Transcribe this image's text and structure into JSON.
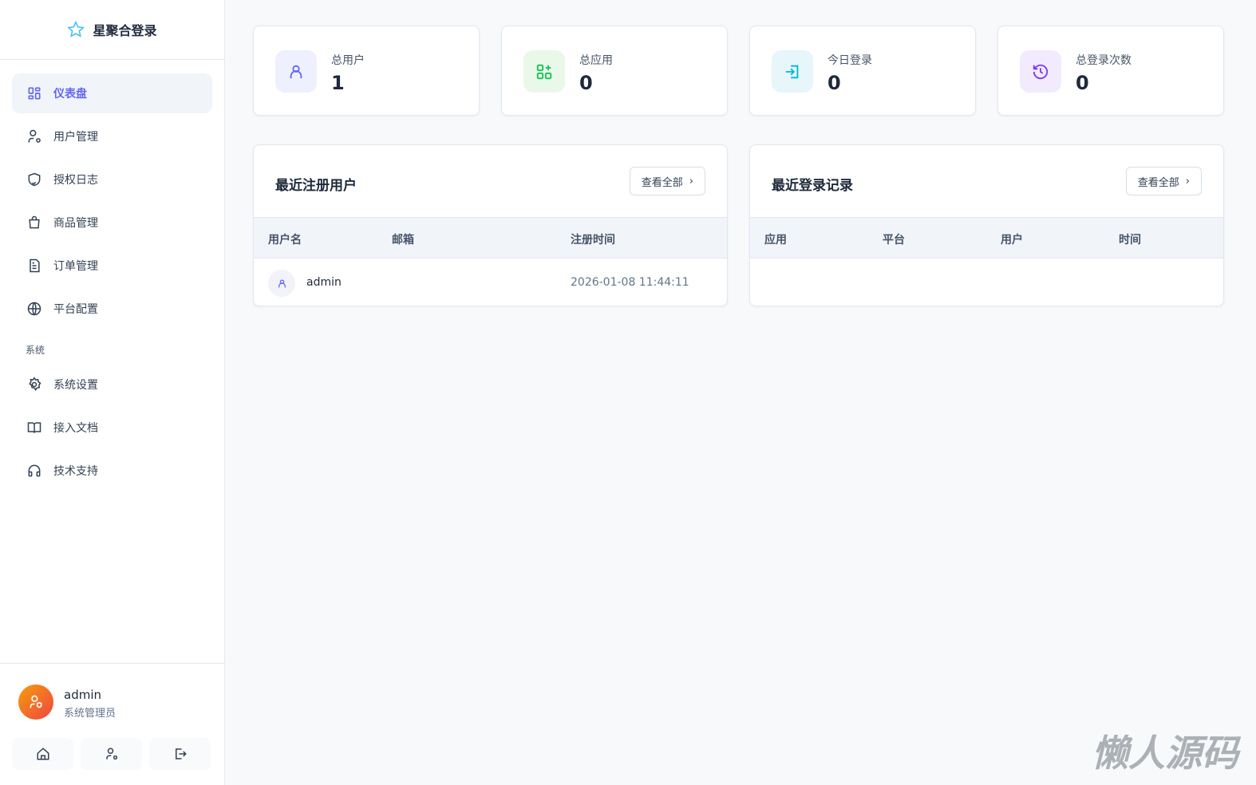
{
  "brand": {
    "title": "星聚合登录"
  },
  "nav": {
    "items": [
      {
        "label": "仪表盘"
      },
      {
        "label": "用户管理"
      },
      {
        "label": "授权日志"
      },
      {
        "label": "商品管理"
      },
      {
        "label": "订单管理"
      },
      {
        "label": "平台配置"
      }
    ],
    "section": "系统",
    "system_items": [
      {
        "label": "系统设置"
      },
      {
        "label": "接入文档"
      },
      {
        "label": "技术支持"
      }
    ]
  },
  "user": {
    "name": "admin",
    "role": "系统管理员"
  },
  "stats": [
    {
      "label": "总用户",
      "value": "1"
    },
    {
      "label": "总应用",
      "value": "0"
    },
    {
      "label": "今日登录",
      "value": "0"
    },
    {
      "label": "总登录次数",
      "value": "0"
    }
  ],
  "recent_users": {
    "title": "最近注册用户",
    "view_all": "查看全部",
    "columns": [
      "用户名",
      "邮箱",
      "注册时间"
    ],
    "rows": [
      {
        "username": "admin",
        "email": "",
        "time": "2026-01-08 11:44:11"
      }
    ]
  },
  "recent_logins": {
    "title": "最近登录记录",
    "view_all": "查看全部",
    "columns": [
      "应用",
      "平台",
      "用户",
      "时间"
    ],
    "rows": []
  },
  "watermark": "懒人源码"
}
